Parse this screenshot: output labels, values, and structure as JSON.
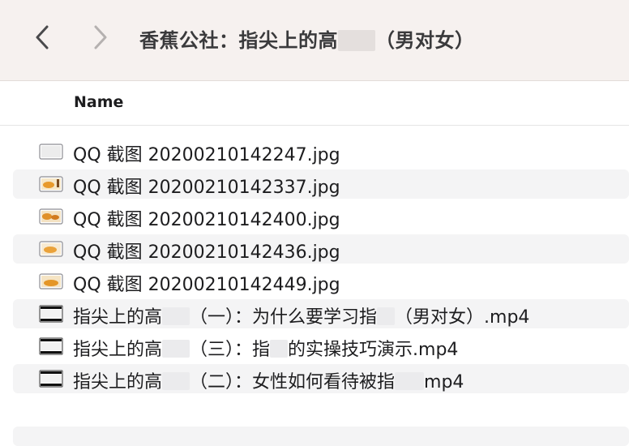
{
  "toolbar": {
    "title_prefix": "香蕉公社：指尖上的",
    "title_partial": "高",
    "title_suffix": "（男对女）",
    "back_icon": "chevron-left-icon",
    "forward_icon": "chevron-right-icon"
  },
  "list_header": {
    "name_label": "Name"
  },
  "files": [
    {
      "name": "QQ 截图 20200210142247.jpg",
      "kind": "image",
      "thumb": "blank"
    },
    {
      "name": "QQ 截图 20200210142337.jpg",
      "kind": "image",
      "thumb": "orange"
    },
    {
      "name": "QQ 截图 20200210142400.jpg",
      "kind": "image",
      "thumb": "orange"
    },
    {
      "name": "QQ 截图 20200210142436.jpg",
      "kind": "image",
      "thumb": "orange"
    },
    {
      "name": "QQ 截图 20200210142449.jpg",
      "kind": "image",
      "thumb": "orange"
    },
    {
      "name_a": "指尖上的高",
      "name_b": "（一）：为什么要学习指",
      "name_c": "（男对女）.mp4",
      "kind": "video"
    },
    {
      "name_a": "指尖上的高",
      "name_b": "（三）：指",
      "name_c": "的实操技巧演示.mp4",
      "kind": "video"
    },
    {
      "name_a": "指尖上的高",
      "name_b": "（二）：女性如何看待被指",
      "name_c": "mp4",
      "kind": "video"
    }
  ]
}
